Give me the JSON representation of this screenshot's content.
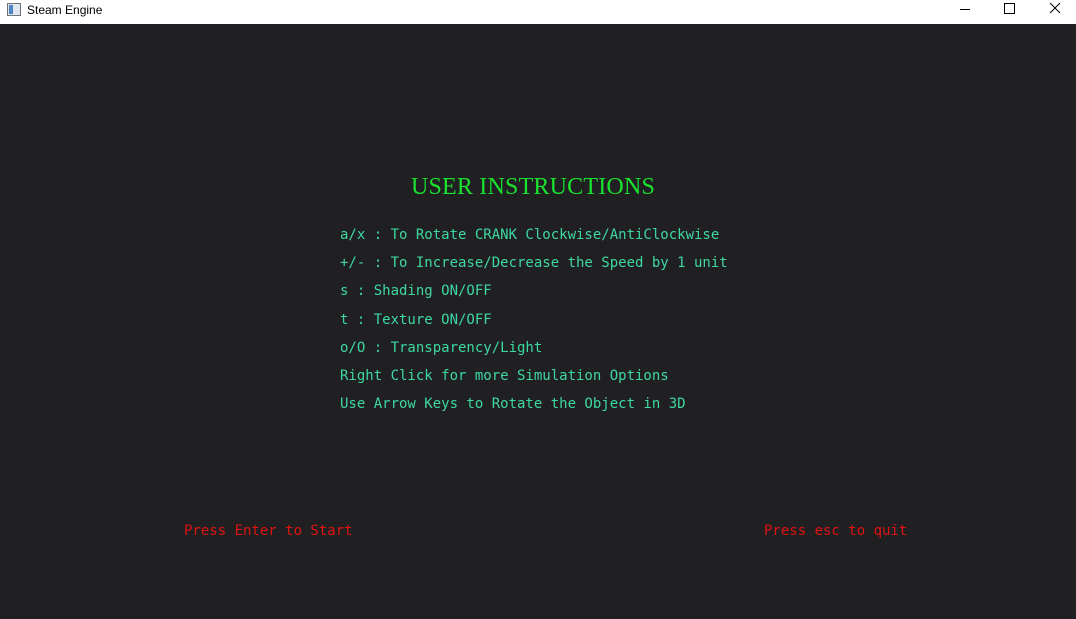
{
  "window": {
    "title": "Steam Engine",
    "icon": "app-window-icon",
    "controls": [
      "minimize-icon",
      "maximize-icon",
      "close-icon"
    ]
  },
  "colors": {
    "background": "#202023",
    "heading": "#19e22e",
    "instructions": "#3ed7a4",
    "footer": "#e01212"
  },
  "screen": {
    "heading": "USER INSTRUCTIONS",
    "instructions": [
      "a/x : To Rotate CRANK Clockwise/AntiClockwise",
      "+/- : To Increase/Decrease the Speed by 1 unit",
      "s : Shading ON/OFF",
      "t : Texture ON/OFF",
      "o/O : Transparency/Light",
      "Right Click for more Simulation Options",
      "Use Arrow Keys to Rotate the Object in 3D"
    ],
    "start_prompt": "Press Enter to Start",
    "quit_prompt": "Press esc to quit"
  }
}
